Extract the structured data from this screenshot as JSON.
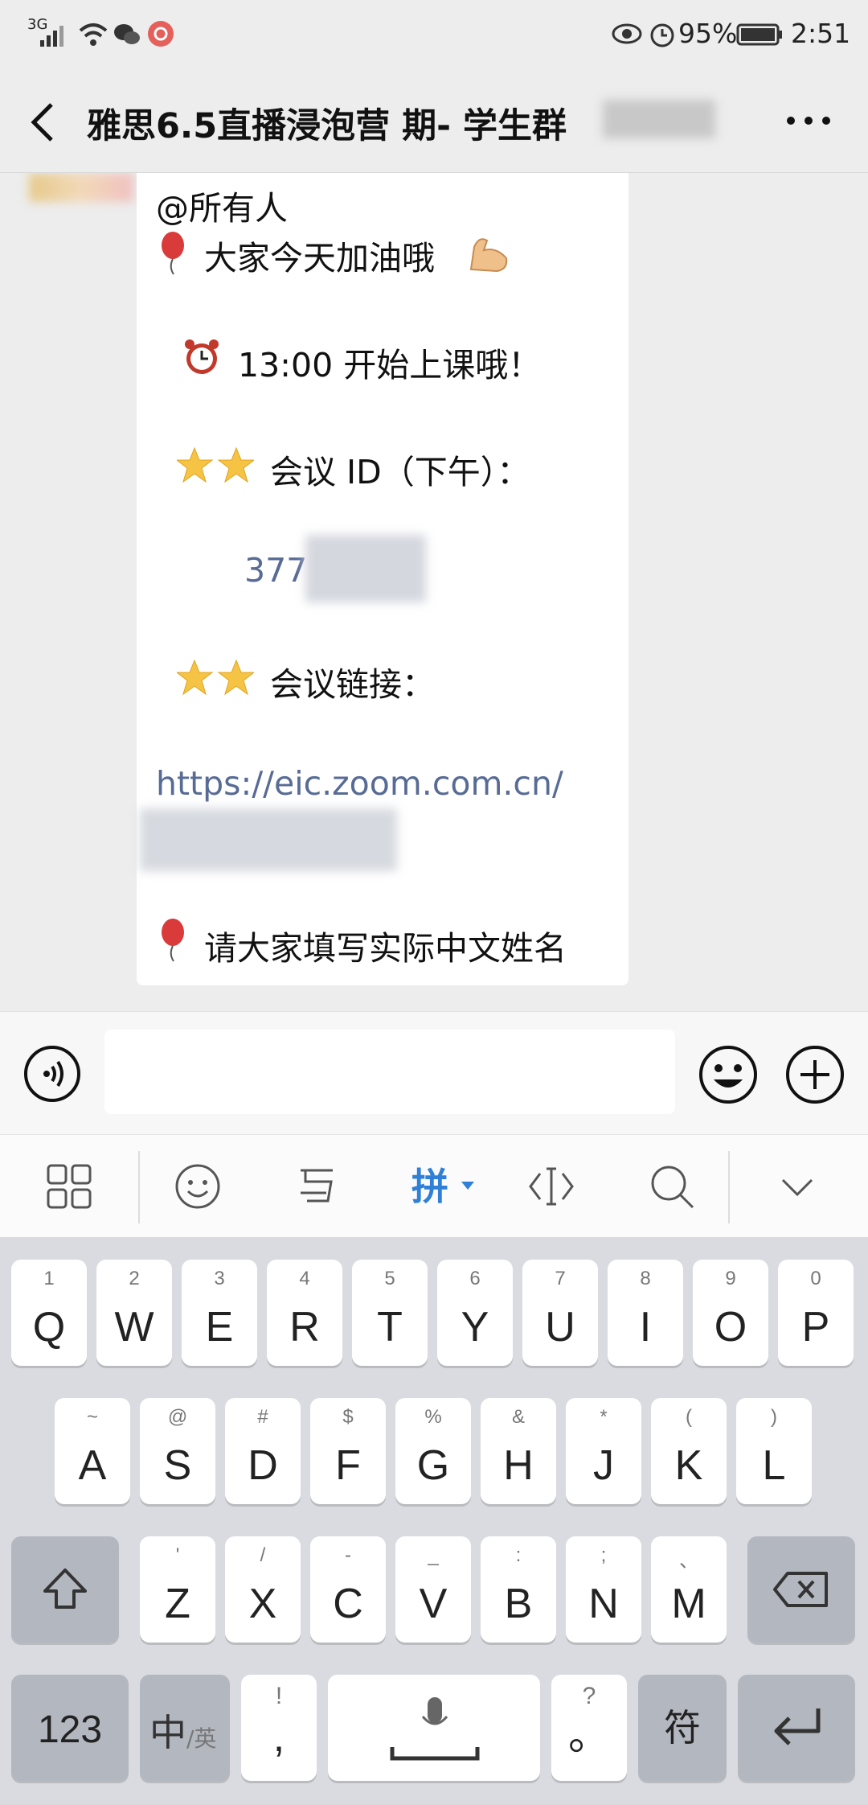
{
  "status_bar": {
    "network": "3G",
    "battery": "95%",
    "time": "2:51"
  },
  "header": {
    "title": "雅思6.5直播浸泡营    期- 学生群"
  },
  "message": {
    "lines": [
      "@所有人",
      "大家今天加油哦",
      "13:00 开始上课哦！",
      "会议 ID（下午）：",
      "377",
      "会议链接：",
      "https://eic.zoom.com.cn/",
      "请大家填写实际中文姓名"
    ]
  },
  "ime_toolbar": {
    "pinyin_label": "拼"
  },
  "keyboard": {
    "row1": [
      {
        "key": "Q",
        "sub": "1"
      },
      {
        "key": "W",
        "sub": "2"
      },
      {
        "key": "E",
        "sub": "3"
      },
      {
        "key": "R",
        "sub": "4"
      },
      {
        "key": "T",
        "sub": "5"
      },
      {
        "key": "Y",
        "sub": "6"
      },
      {
        "key": "U",
        "sub": "7"
      },
      {
        "key": "I",
        "sub": "8"
      },
      {
        "key": "O",
        "sub": "9"
      },
      {
        "key": "P",
        "sub": "0"
      }
    ],
    "row2": [
      {
        "key": "A",
        "sub": "~"
      },
      {
        "key": "S",
        "sub": "@"
      },
      {
        "key": "D",
        "sub": "#"
      },
      {
        "key": "F",
        "sub": "$"
      },
      {
        "key": "G",
        "sub": "%"
      },
      {
        "key": "H",
        "sub": "&"
      },
      {
        "key": "J",
        "sub": "*"
      },
      {
        "key": "K",
        "sub": "("
      },
      {
        "key": "L",
        "sub": ")"
      }
    ],
    "row3": [
      {
        "key": "Z",
        "sub": "'"
      },
      {
        "key": "X",
        "sub": "/"
      },
      {
        "key": "C",
        "sub": "-"
      },
      {
        "key": "V",
        "sub": "_"
      },
      {
        "key": "B",
        "sub": ":"
      },
      {
        "key": "N",
        "sub": ";"
      },
      {
        "key": "M",
        "sub": "、"
      }
    ],
    "row4": {
      "num_label": "123",
      "lang_main": "中",
      "lang_sub": "/英",
      "punct_top": "!",
      "punct_main": ",",
      "period_top": "?",
      "period_main": "。",
      "symbol_label": "符"
    }
  }
}
